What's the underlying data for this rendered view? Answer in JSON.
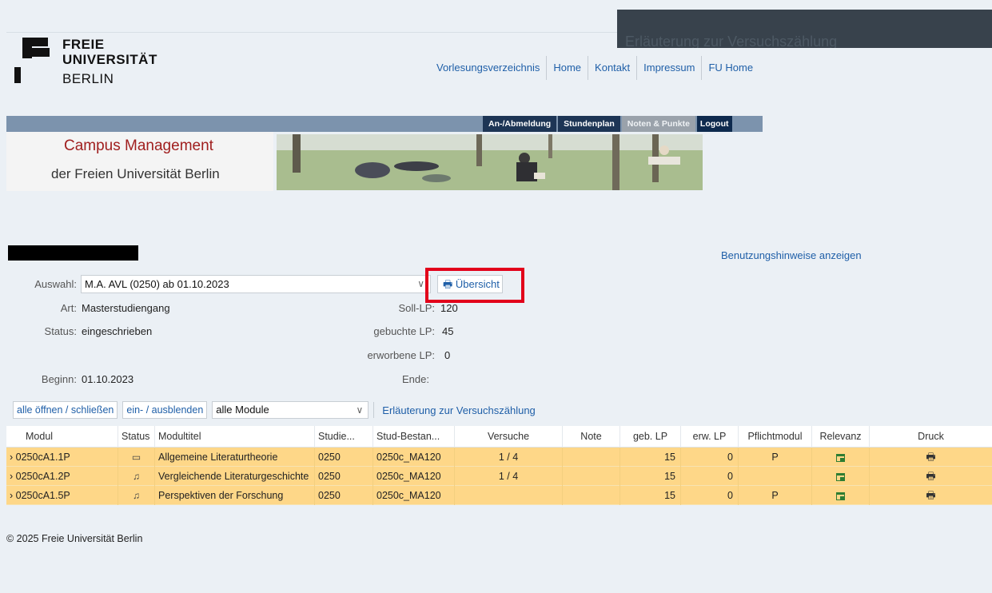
{
  "tooltip": {
    "text": "Erläuterung zur Versuchszählung"
  },
  "logo": {
    "line1": "FREIE",
    "line2": "UNIVERSITÄT",
    "line3": "BERLIN"
  },
  "topnav": [
    "Vorlesungsverzeichnis",
    "Home",
    "Kontakt",
    "Impressum",
    "FU Home"
  ],
  "mainnav": {
    "items": [
      "An-/Abmeldung",
      "Stundenplan",
      "Noten & Punkte",
      "Logout"
    ],
    "active": "Noten & Punkte"
  },
  "campus": {
    "title": "Campus Management",
    "subtitle": "der Freien Universität Berlin"
  },
  "help_link": "Benutzungshinweise anzeigen",
  "info": {
    "auswahl_label": "Auswahl:",
    "auswahl_value": "M.A. AVL (0250) ab 01.10.2023",
    "uebersicht_button": "Übersicht",
    "art_label": "Art:",
    "art_value": "Masterstudiengang",
    "status_label": "Status:",
    "status_value": "eingeschrieben",
    "beginn_label": "Beginn:",
    "beginn_value": "01.10.2023",
    "soll_label": "Soll-LP:",
    "soll_value": "120",
    "gebucht_label": "gebuchte LP:",
    "gebucht_value": "45",
    "erworben_label": "erworbene LP:",
    "erworben_value": "0",
    "ende_label": "Ende:",
    "ende_value": ""
  },
  "toolbar": {
    "toggle_all": "alle öffnen / schließen",
    "show_hide": "ein- / ausblenden",
    "module_filter": "alle Module",
    "explain_link": "Erläuterung zur Versuchszählung"
  },
  "table": {
    "columns": [
      "Modul",
      "Status",
      "Modultitel",
      "Studie...",
      "Stud-Bestan...",
      "Versuche",
      "Note",
      "geb. LP",
      "erw. LP",
      "Pflichtmodul",
      "Relevanz",
      "Druck"
    ],
    "rows": [
      {
        "modul": "0250cA1.1P",
        "status": "calendar-icon",
        "titel": "Allgemeine Literaturtheorie",
        "studie": "0250",
        "bestand": "0250c_MA120",
        "versuche": "1 / 4",
        "note": "",
        "geb": "15",
        "erw": "0",
        "pflicht": "P"
      },
      {
        "modul": "0250cA1.2P",
        "status": "bell-icon",
        "titel": "Vergleichende Literaturgeschichte",
        "studie": "0250",
        "bestand": "0250c_MA120",
        "versuche": "1 / 4",
        "note": "",
        "geb": "15",
        "erw": "0",
        "pflicht": ""
      },
      {
        "modul": "0250cA1.5P",
        "status": "bell-icon",
        "titel": "Perspektiven der Forschung",
        "studie": "0250",
        "bestand": "0250c_MA120",
        "versuche": "",
        "note": "",
        "geb": "15",
        "erw": "0",
        "pflicht": "P"
      }
    ]
  },
  "footer": "© 2025 Freie Universität Berlin",
  "colors": {
    "row_bg": "#fed788",
    "nav_dark": "#1d3555",
    "link": "#1f5fa8",
    "campus_red": "#a01f1f",
    "highlight": "#e2001a"
  }
}
